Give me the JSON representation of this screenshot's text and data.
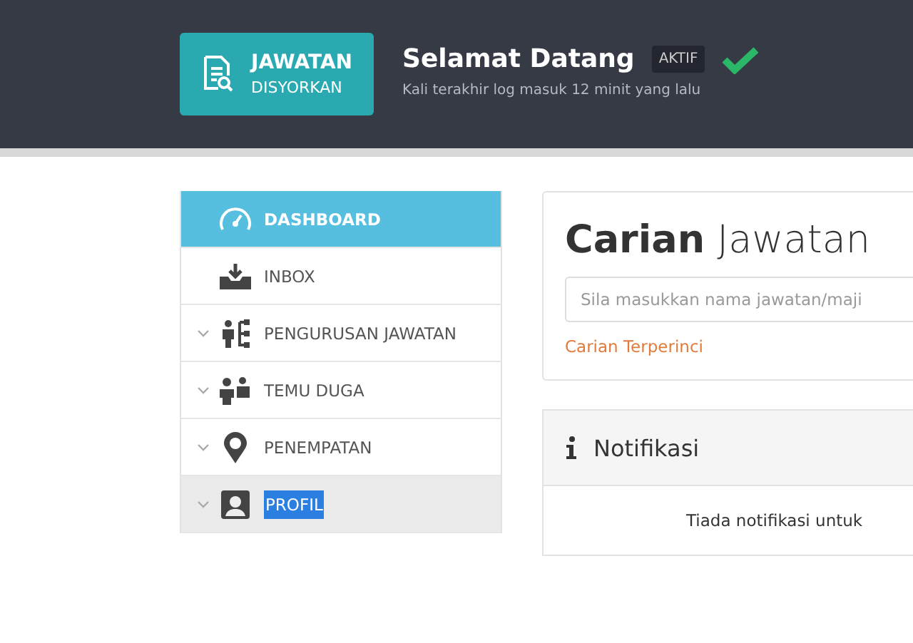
{
  "header": {
    "tile": {
      "title": "JAWATAN",
      "subtitle": "DISYORKAN"
    },
    "greeting": "Selamat Datang",
    "status_badge": "AKTIF",
    "verified": true,
    "last_login": "Kali terakhir log masuk 12 minit yang lalu"
  },
  "sidebar": {
    "items": [
      {
        "label": "DASHBOARD",
        "selected": true,
        "expandable": false,
        "highlighted": false
      },
      {
        "label": "INBOX",
        "selected": false,
        "expandable": false,
        "highlighted": false
      },
      {
        "label": "PENGURUSAN JAWATAN",
        "selected": false,
        "expandable": true,
        "highlighted": false
      },
      {
        "label": "TEMU DUGA",
        "selected": false,
        "expandable": true,
        "highlighted": false
      },
      {
        "label": "PENEMPATAN",
        "selected": false,
        "expandable": true,
        "highlighted": false
      },
      {
        "label": "PROFIL",
        "selected": false,
        "expandable": true,
        "highlighted": true
      }
    ]
  },
  "search_panel": {
    "title_bold": "Carian",
    "title_light": "Jawatan",
    "placeholder": "Sila masukkan nama jawatan/maji",
    "advanced_link": "Carian Terperinci"
  },
  "notifications": {
    "title": "Notifikasi",
    "message": "Tiada notifikasi untuk"
  }
}
